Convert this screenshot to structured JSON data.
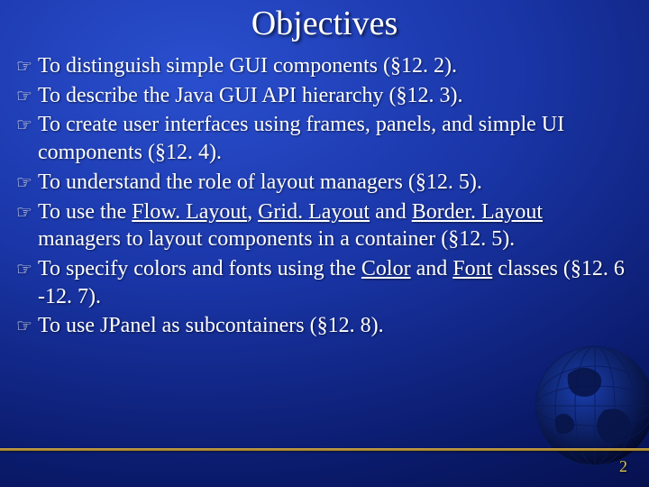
{
  "title": "Objectives",
  "bullet_glyph": "☞",
  "bullets": [
    {
      "pre": "To distinguish simple GUI components (§12. 2).",
      "links": [],
      "post": ""
    },
    {
      "pre": " To describe the Java GUI API hierarchy (§12. 3).",
      "links": [],
      "post": ""
    },
    {
      "pre": "To create user interfaces using frames, panels, and simple UI components (§12. 4).",
      "links": [],
      "post": ""
    },
    {
      "pre": "To understand the role of layout managers (§12. 5).",
      "links": [],
      "post": ""
    },
    {
      "pre": "To use the ",
      "links": [
        "Flow. Layout",
        "Grid. Layout",
        "Border. Layout"
      ],
      "post": " managers to layout components in a container (§12. 5)."
    },
    {
      "pre": "To specify colors and fonts using the ",
      "links": [
        "Color",
        "Font"
      ],
      "post": " classes (§12. 6 -12. 7)."
    },
    {
      "pre": "To use JPanel as subcontainers (§12. 8).",
      "links": [],
      "post": ""
    }
  ],
  "page_number": "2"
}
